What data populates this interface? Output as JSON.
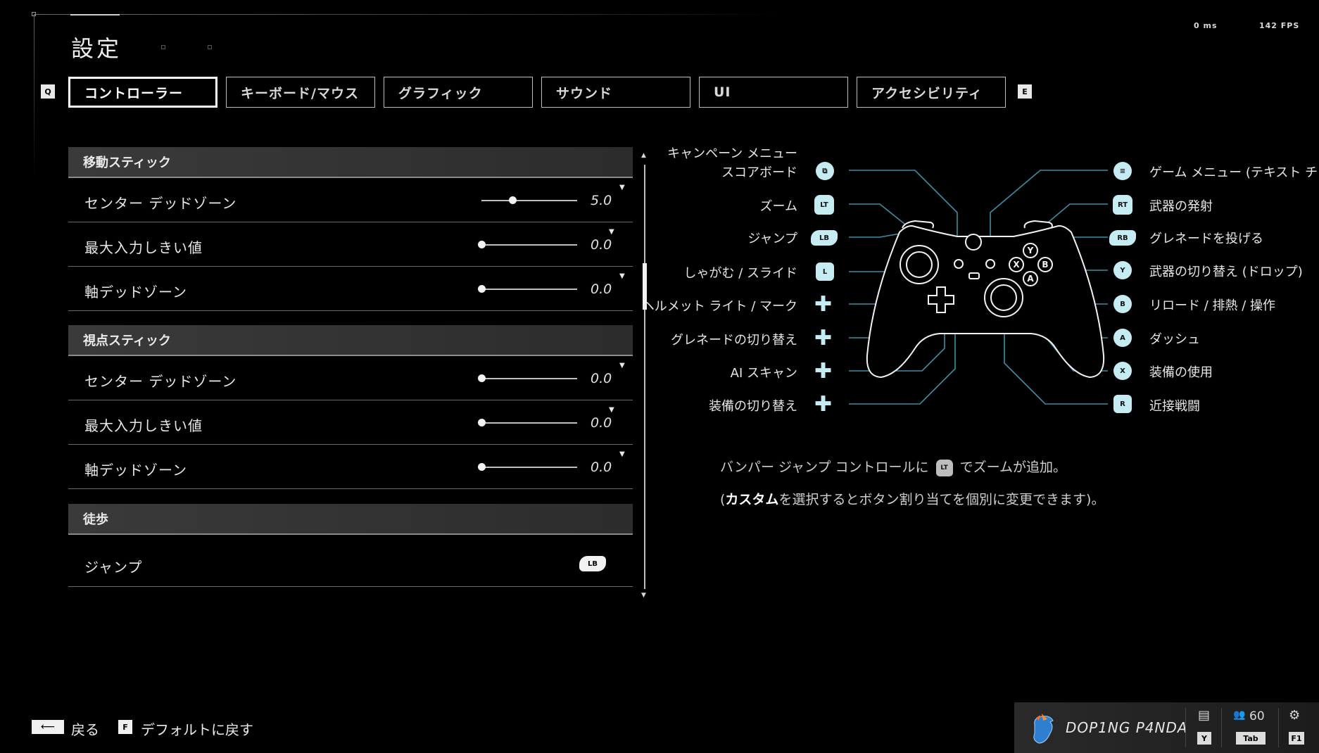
{
  "header": {
    "title": "設定",
    "latency": "0 ms",
    "fps": "142 FPS"
  },
  "tabs": {
    "prev_key": "Q",
    "next_key": "E",
    "items": [
      {
        "label": "コントローラー",
        "active": true
      },
      {
        "label": "キーボード/マウス",
        "active": false
      },
      {
        "label": "グラフィック",
        "active": false
      },
      {
        "label": "サウンド",
        "active": false
      },
      {
        "label": "UI",
        "active": false
      },
      {
        "label": "アクセシビリティ",
        "active": false
      }
    ]
  },
  "settings": {
    "move_stick": {
      "header": "移動スティック",
      "center_deadzone": {
        "label": "センター デッドゾーン",
        "value": "5.0",
        "position": 0.32
      },
      "max_threshold": {
        "label": "最大入力しきい値",
        "value": "0.0",
        "position": 0.0
      },
      "axis_deadzone": {
        "label": "軸デッドゾーン",
        "value": "0.0",
        "position": 0.0
      }
    },
    "look_stick": {
      "header": "視点スティック",
      "center_deadzone": {
        "label": "センター デッドゾーン",
        "value": "0.0",
        "position": 0.0
      },
      "max_threshold": {
        "label": "最大入力しきい値",
        "value": "0.0",
        "position": 0.0
      },
      "axis_deadzone": {
        "label": "軸デッドゾーン",
        "value": "0.0",
        "position": 0.0
      }
    },
    "on_foot": {
      "header": "徒歩",
      "jump": {
        "label": "ジャンプ",
        "binding": "LB"
      }
    }
  },
  "controller_map": {
    "accent_color": "#c6ecf3",
    "left": [
      {
        "label": "キャンペーン メニュー",
        "icon": ""
      },
      {
        "label": "スコアボード",
        "icon": "view-button-icon"
      },
      {
        "label": "ズーム",
        "icon": "LT"
      },
      {
        "label": "ジャンプ",
        "icon": "LB"
      },
      {
        "label": "しゃがむ / スライド",
        "icon": "L"
      },
      {
        "label": "ヘルメット ライト / マーク",
        "icon": "dpad-up-icon"
      },
      {
        "label": "グレネードの切り替え",
        "icon": "dpad-left-icon"
      },
      {
        "label": "AI スキャン",
        "icon": "dpad-right-icon"
      },
      {
        "label": "装備の切り替え",
        "icon": "dpad-down-icon"
      }
    ],
    "right": [
      {
        "label": "ゲーム メニュー (テキスト チ",
        "icon": "≡"
      },
      {
        "label": "武器の発射",
        "icon": "RT"
      },
      {
        "label": "グレネードを投げる",
        "icon": "RB"
      },
      {
        "label": "武器の切り替え (ドロップ)",
        "icon": "Y"
      },
      {
        "label": "リロード / 排熱 / 操作",
        "icon": "B"
      },
      {
        "label": "ダッシュ",
        "icon": "A"
      },
      {
        "label": "装備の使用",
        "icon": "X"
      },
      {
        "label": "近接戦闘",
        "icon": "R"
      }
    ],
    "note1_prefix": "バンパー ジャンプ コントロールに",
    "note1_icon": "LT",
    "note1_suffix": "でズームが追加。",
    "note2_open": "(",
    "note2_bold": "カスタム",
    "note2_rest": "を選択するとボタン割り当てを個別に変更できます)。"
  },
  "footer": {
    "back_key": "⟵",
    "back_label": "戻る",
    "default_key": "F",
    "default_label": "デフォルトに戻す",
    "player_name": "DOP1NG P4NDA",
    "chat_key": "Y",
    "friends_count": "60",
    "friends_key": "Tab",
    "settings_key": "F1"
  }
}
